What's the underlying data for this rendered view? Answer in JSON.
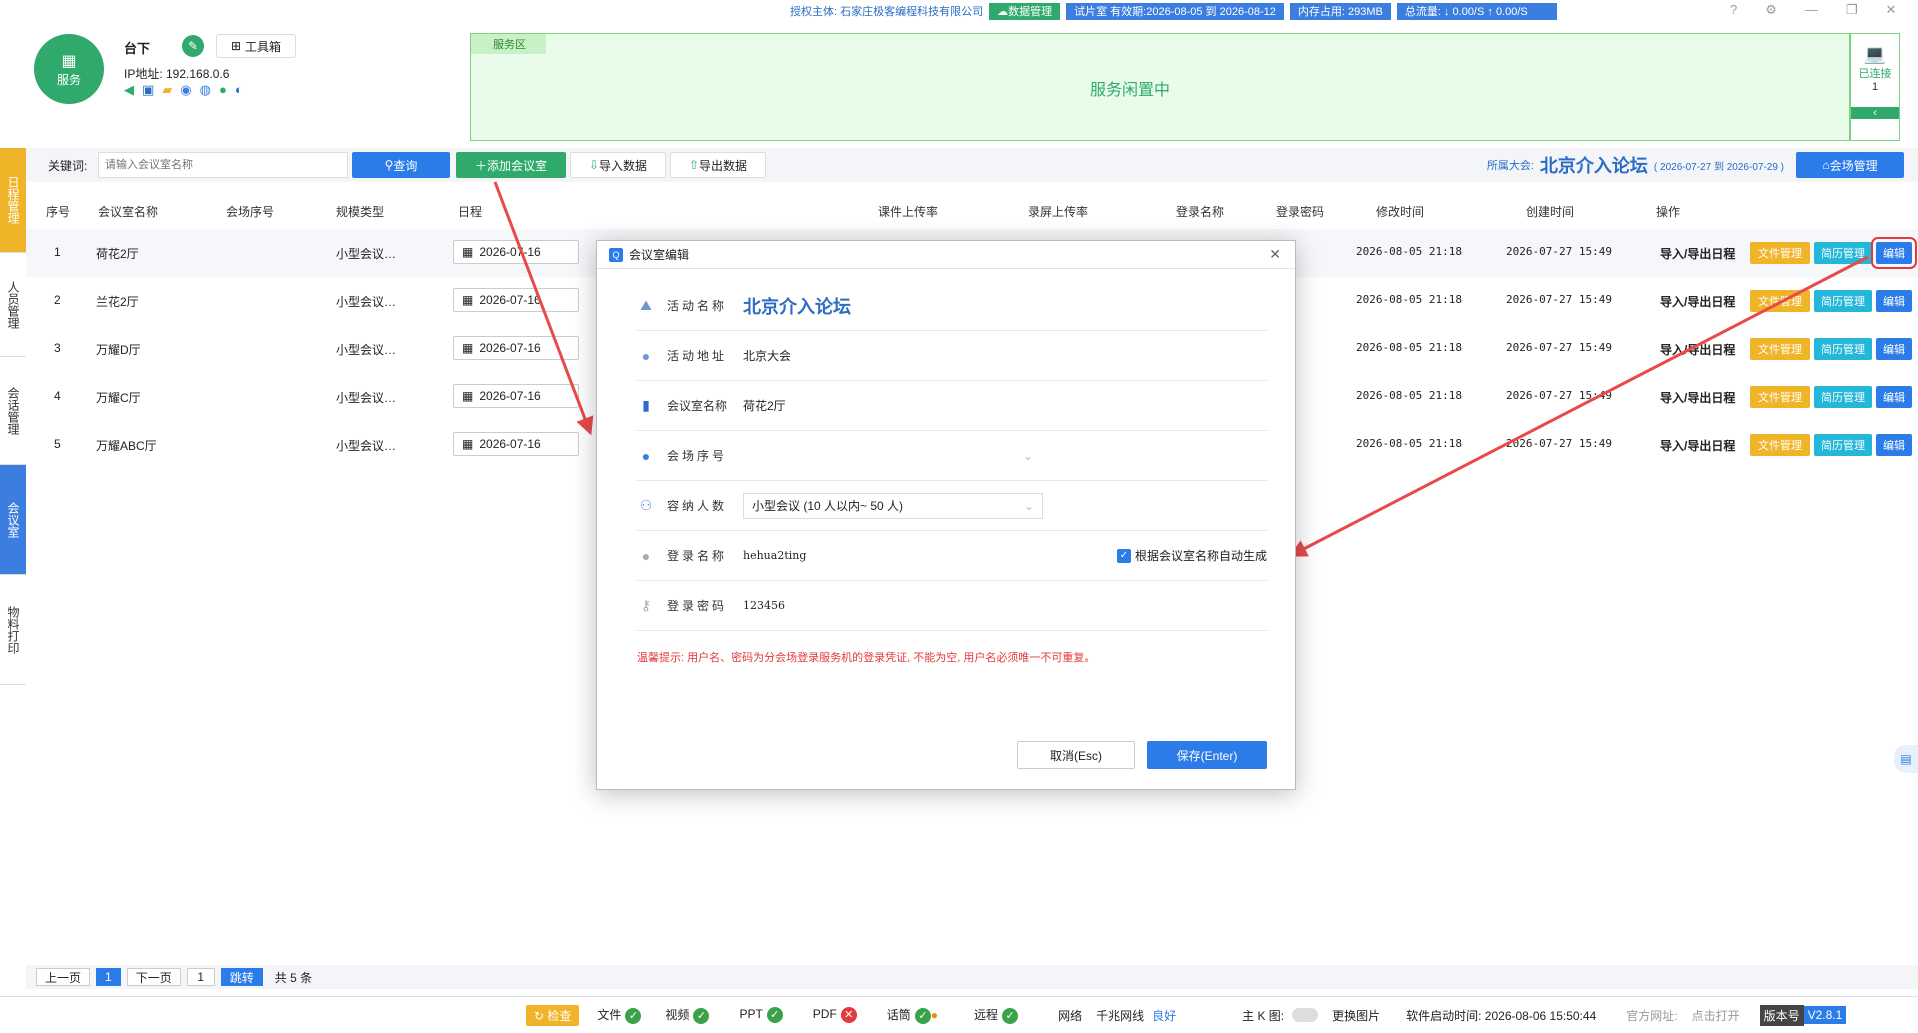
{
  "topbar": {
    "license_label": "授权主体: 石家庄极客编程科技有限公司",
    "data_mgmt": "数据管理",
    "trial": "试片室 有效期:2026-08-05 到 2026-08-12",
    "memory": "内存占用: 293MB",
    "traffic": "总流量: ↓ 0.00/S  ↑ 0.00/S"
  },
  "header": {
    "logo_label": "服务",
    "site_name": "台下",
    "toolbox": "工具箱",
    "ip": "IP地址: 192.168.0.6",
    "service_area_label": "服务区",
    "service_status": "服务闲置中",
    "connected_label": "已连接",
    "connected_count": "1"
  },
  "leftnav": [
    "日程管理",
    "人员管理",
    "会话管理",
    "会议室",
    "物料打印"
  ],
  "toolbar": {
    "keyword_label": "关键词:",
    "search_placeholder": "请输入会议室名称",
    "query": "查询",
    "add": "添加会议室",
    "import": "导入数据",
    "export": "导出数据",
    "conf_prefix": "所属大会:",
    "conf_name": "北京介入论坛",
    "conf_dates": "( 2026-07-27 到 2026-07-29 )",
    "venue_mgmt": "会场管理"
  },
  "table": {
    "headers": [
      "序号",
      "会议室名称",
      "会场序号",
      "规模类型",
      "日程",
      "课件上传率",
      "录屏上传率",
      "登录名称",
      "登录密码",
      "修改时间",
      "创建时间",
      "操作"
    ],
    "rows": [
      {
        "no": "1",
        "name": "荷花2厅",
        "scale": "小型会议…",
        "date": "2026-07-16",
        "mod": "2026-08-05 21:18",
        "created": "2026-07-27 15:49"
      },
      {
        "no": "2",
        "name": "兰花2厅",
        "scale": "小型会议…",
        "date": "2026-07-16",
        "mod": "2026-08-05 21:18",
        "created": "2026-07-27 15:49"
      },
      {
        "no": "3",
        "name": "万耀D厅",
        "scale": "小型会议…",
        "date": "2026-07-16",
        "mod": "2026-08-05 21:18",
        "created": "2026-07-27 15:49"
      },
      {
        "no": "4",
        "name": "万耀C厅",
        "scale": "小型会议…",
        "date": "2026-07-16",
        "mod": "2026-08-05 21:18",
        "created": "2026-07-27 15:49"
      },
      {
        "no": "5",
        "name": "万耀ABC厅",
        "scale": "小型会议…",
        "date": "2026-07-16",
        "mod": "2026-08-05 21:18",
        "created": "2026-07-27 15:49"
      }
    ],
    "ops": {
      "io": "导入/导出日程",
      "file": "文件管理",
      "cv": "简历管理",
      "edit": "编辑"
    }
  },
  "pager": {
    "prev": "上一页",
    "page": "1",
    "next": "下一页",
    "input": "1",
    "jump": "跳转",
    "total": "共 5 条"
  },
  "footer": {
    "check": "检查",
    "file": "文件",
    "video": "视频",
    "ppt": "PPT",
    "pdf": "PDF",
    "remote_talk": "话筒",
    "remote": "远程",
    "net": "网络",
    "net_type": "千兆网线",
    "net_state": "良好",
    "main_k": "主 K 图:",
    "change_img": "更换图片",
    "start_time": "软件启动时间: 2026-08-06 15:50:44",
    "site": "官方网址:",
    "click": "点击打开",
    "ver_label": "版本号",
    "ver": "V2.8.1"
  },
  "modal": {
    "title": "会议室编辑",
    "activity_label": "活动名称",
    "activity_value": "北京介入论坛",
    "address_label": "活动地址",
    "address_value": "北京大会",
    "room_label": "会议室名称",
    "room_value": "荷花2厅",
    "seq_label": "会场序号",
    "cap_label": "容纳人数",
    "cap_value": "小型会议 (10 人以内~ 50 人)",
    "login_label": "登录名称",
    "login_value": "hehua2ting",
    "auto_label": "根据会议室名称自动生成",
    "pwd_label": "登录密码",
    "pwd_value": "123456",
    "hint": "温馨提示: 用户名、密码为分会场登录服务机的登录凭证, 不能为空, 用户名必须唯一不可重复。",
    "cancel": "取消(Esc)",
    "save": "保存(Enter)"
  }
}
